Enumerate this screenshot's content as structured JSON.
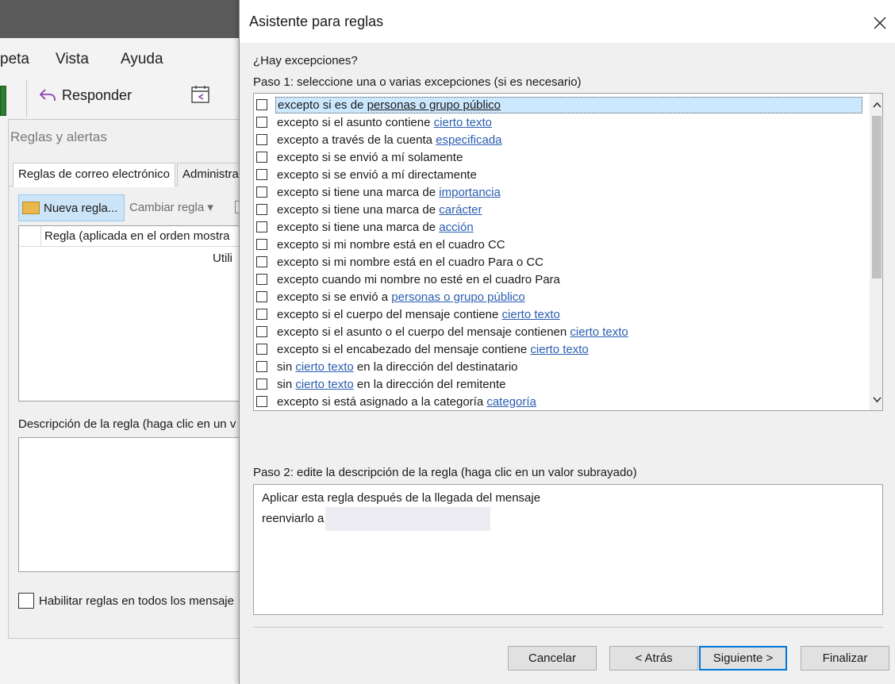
{
  "background": {
    "menu": [
      "peta",
      "Vista",
      "Ayuda"
    ],
    "reply_label": "Responder"
  },
  "rules_dialog": {
    "title": "Reglas y alertas",
    "tabs": [
      "Reglas de correo electrónico",
      "Administra"
    ],
    "new_rule_label": "Nueva regla...",
    "change_rule_label": "Cambiar regla ▾",
    "grid_header": "Regla (aplicada en el orden mostra",
    "grid_cell": "Utili",
    "description_label": "Descripción de la regla (haga clic en un v",
    "enable_label": "Habilitar reglas en todos los mensaje"
  },
  "wizard": {
    "title": "Asistente para reglas",
    "question": "¿Hay excepciones?",
    "step1_label": "Paso 1: seleccione una o varias excepciones (si es necesario)",
    "exceptions": [
      {
        "pre": "excepto si es de ",
        "link": "personas o grupo público",
        "post": "",
        "selected": true
      },
      {
        "pre": "excepto si el asunto contiene ",
        "link": "cierto texto",
        "post": ""
      },
      {
        "pre": "excepto a través de la cuenta ",
        "link": "especificada",
        "post": ""
      },
      {
        "pre": "excepto si se envió a mí solamente",
        "link": "",
        "post": ""
      },
      {
        "pre": "excepto si se envió a mí directamente",
        "link": "",
        "post": ""
      },
      {
        "pre": "excepto si tiene una marca de ",
        "link": "importancia",
        "post": ""
      },
      {
        "pre": "excepto si tiene una marca de ",
        "link": "carácter",
        "post": ""
      },
      {
        "pre": "excepto si tiene una marca de ",
        "link": "acción",
        "post": ""
      },
      {
        "pre": "excepto si mi nombre está en el cuadro CC",
        "link": "",
        "post": ""
      },
      {
        "pre": "excepto si mi nombre está en el cuadro Para o CC",
        "link": "",
        "post": ""
      },
      {
        "pre": "excepto cuando mi nombre no esté en el cuadro Para",
        "link": "",
        "post": ""
      },
      {
        "pre": "excepto si se envió a ",
        "link": "personas o grupo público",
        "post": ""
      },
      {
        "pre": "excepto si el cuerpo del mensaje contiene ",
        "link": "cierto texto",
        "post": ""
      },
      {
        "pre": "excepto si el asunto o el cuerpo del mensaje contienen ",
        "link": "cierto texto",
        "post": ""
      },
      {
        "pre": "excepto si el encabezado del mensaje contiene ",
        "link": "cierto texto",
        "post": ""
      },
      {
        "pre": "sin ",
        "link": "cierto texto",
        "post": " en la dirección del destinatario"
      },
      {
        "pre": "sin ",
        "link": "cierto texto",
        "post": " en la dirección del remitente"
      },
      {
        "pre": "excepto si está asignado a la categoría ",
        "link": "categoría",
        "post": ""
      }
    ],
    "step2_label": "Paso 2: edite la descripción de la regla (haga clic en un valor subrayado)",
    "description_lines": [
      "Aplicar esta regla después de la llegada del mensaje",
      "reenviarlo a"
    ],
    "buttons": {
      "cancel": "Cancelar",
      "back": "< Atrás",
      "next": "Siguiente >",
      "finish": "Finalizar"
    },
    "colors": {
      "link": "#2a5db0",
      "selection": "#cce8ff",
      "default_button_border": "#0078d7"
    }
  }
}
